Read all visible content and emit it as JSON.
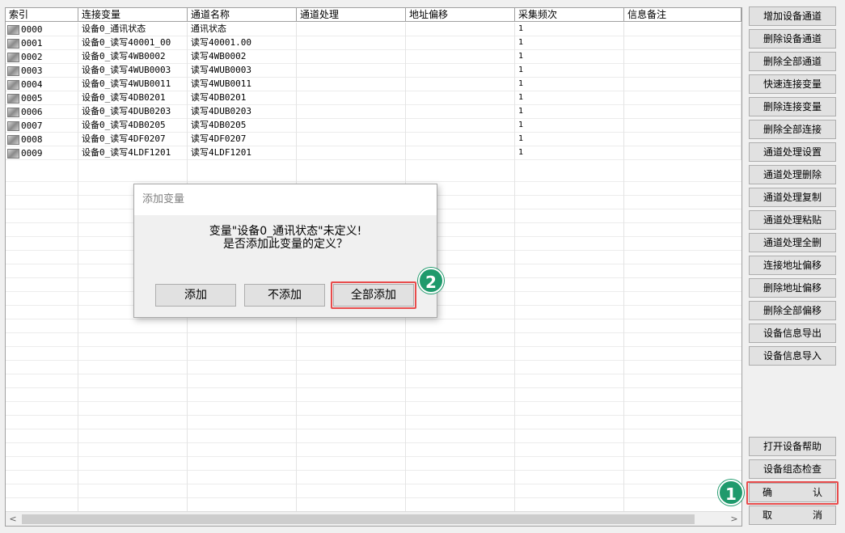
{
  "grid": {
    "columns": [
      "索引",
      "连接变量",
      "通道名称",
      "通道处理",
      "地址偏移",
      "采集频次",
      "信息备注"
    ],
    "rows": [
      {
        "index": "0000",
        "var": "设备0_通讯状态",
        "name": "通讯状态",
        "proc": "",
        "offset": "",
        "freq": "1",
        "note": ""
      },
      {
        "index": "0001",
        "var": "设备0_读写40001_00",
        "name": "读写40001.00",
        "proc": "",
        "offset": "",
        "freq": "1",
        "note": ""
      },
      {
        "index": "0002",
        "var": "设备0_读写4WB0002",
        "name": "读写4WB0002",
        "proc": "",
        "offset": "",
        "freq": "1",
        "note": ""
      },
      {
        "index": "0003",
        "var": "设备0_读写4WUB0003",
        "name": "读写4WUB0003",
        "proc": "",
        "offset": "",
        "freq": "1",
        "note": ""
      },
      {
        "index": "0004",
        "var": "设备0_读写4WUB0011",
        "name": "读写4WUB0011",
        "proc": "",
        "offset": "",
        "freq": "1",
        "note": ""
      },
      {
        "index": "0005",
        "var": "设备0_读写4DB0201",
        "name": "读写4DB0201",
        "proc": "",
        "offset": "",
        "freq": "1",
        "note": ""
      },
      {
        "index": "0006",
        "var": "设备0_读写4DUB0203",
        "name": "读写4DUB0203",
        "proc": "",
        "offset": "",
        "freq": "1",
        "note": ""
      },
      {
        "index": "0007",
        "var": "设备0_读写4DB0205",
        "name": "读写4DB0205",
        "proc": "",
        "offset": "",
        "freq": "1",
        "note": ""
      },
      {
        "index": "0008",
        "var": "设备0_读写4DF0207",
        "name": "读写4DF0207",
        "proc": "",
        "offset": "",
        "freq": "1",
        "note": ""
      },
      {
        "index": "0009",
        "var": "设备0_读写4LDF1201",
        "name": "读写4LDF1201",
        "proc": "",
        "offset": "",
        "freq": "1",
        "note": ""
      }
    ]
  },
  "scroll": {
    "left_arrow": "<",
    "right_arrow": ">"
  },
  "sidebar": {
    "top_buttons": [
      "增加设备通道",
      "删除设备通道",
      "删除全部通道",
      "快速连接变量",
      "删除连接变量",
      "删除全部连接",
      "通道处理设置",
      "通道处理删除",
      "通道处理复制",
      "通道处理粘贴",
      "通道处理全删",
      "连接地址偏移",
      "删除地址偏移",
      "删除全部偏移",
      "设备信息导出",
      "设备信息导入"
    ],
    "help": "打开设备帮助",
    "check": "设备组态检查",
    "confirm": [
      "确",
      "认"
    ],
    "cancel": [
      "取",
      "消"
    ]
  },
  "dialog": {
    "title": "添加变量",
    "line1": "变量\"设备0_通讯状态\"未定义!",
    "line2": "是否添加此变量的定义？",
    "btn_add": "添加",
    "btn_no_add": "不添加",
    "btn_add_all": "全部添加"
  },
  "markers": {
    "m1": "1",
    "m2": "2"
  },
  "colors": {
    "highlight": "#e84c4c",
    "marker": "#1f9a6c"
  }
}
